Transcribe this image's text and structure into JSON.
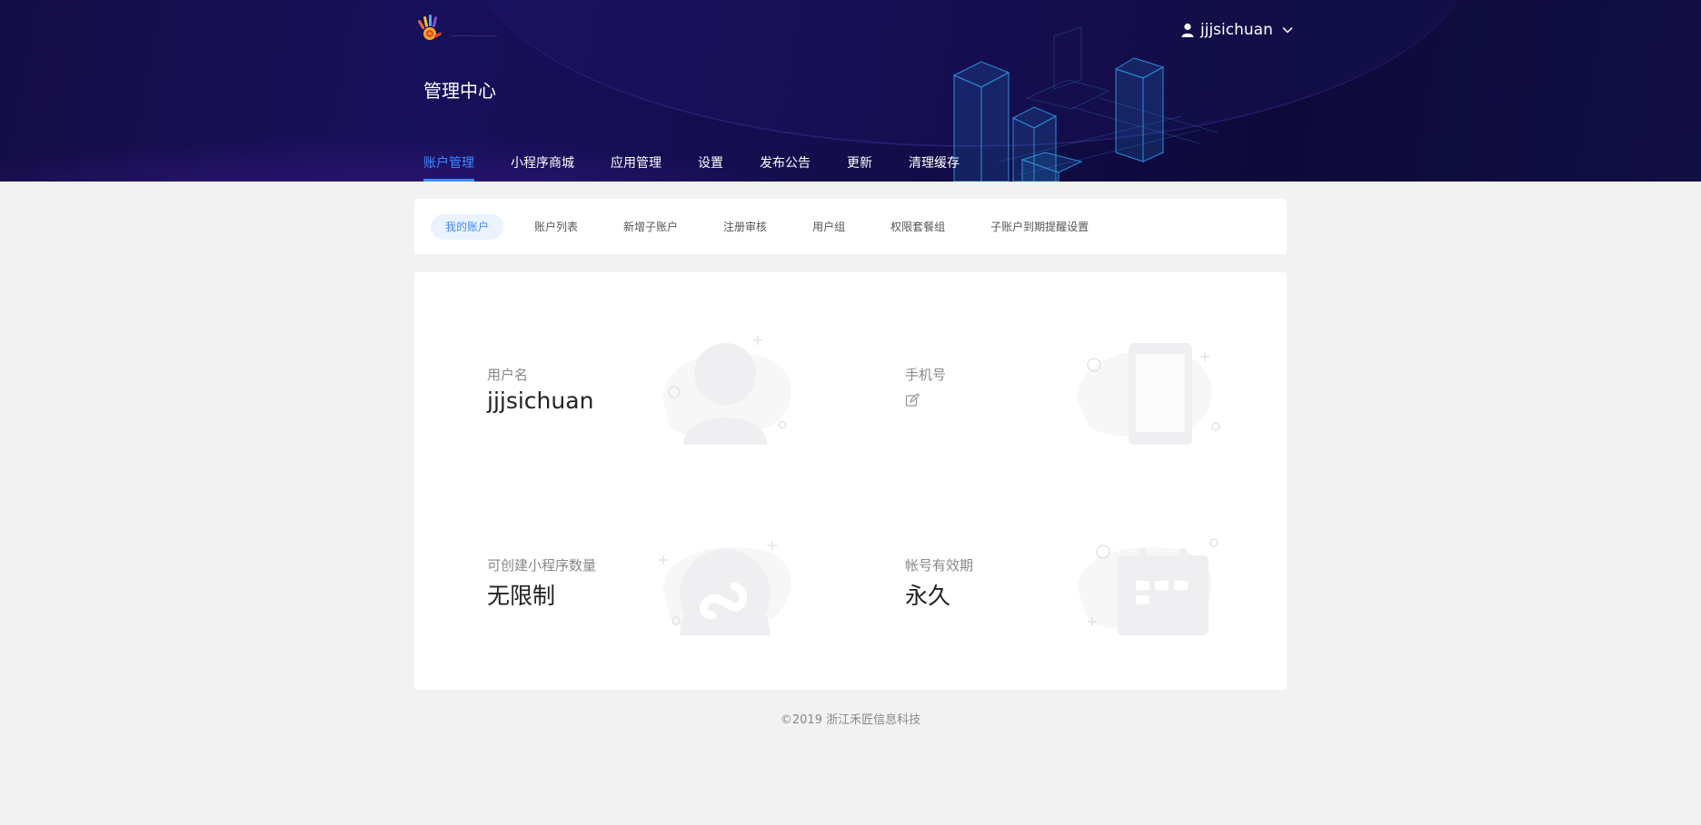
{
  "header": {
    "title": "管理中心",
    "username": "jjjsichuan",
    "nav": [
      {
        "label": "账户管理",
        "active": true
      },
      {
        "label": "小程序商城",
        "active": false
      },
      {
        "label": "应用管理",
        "active": false
      },
      {
        "label": "设置",
        "active": false
      },
      {
        "label": "发布公告",
        "active": false
      },
      {
        "label": "更新",
        "active": false
      },
      {
        "label": "清理缓存",
        "active": false
      }
    ]
  },
  "subnav": [
    {
      "label": "我的账户",
      "active": true
    },
    {
      "label": "账户列表",
      "active": false
    },
    {
      "label": "新增子账户",
      "active": false
    },
    {
      "label": "注册审核",
      "active": false
    },
    {
      "label": "用户组",
      "active": false
    },
    {
      "label": "权限套餐组",
      "active": false
    },
    {
      "label": "子账户到期提醒设置",
      "active": false
    }
  ],
  "account": {
    "username_label": "用户名",
    "username_value": "jjjsichuan",
    "phone_label": "手机号",
    "miniapp_label": "可创建小程序数量",
    "miniapp_value": "无限制",
    "expire_label": "帐号有效期",
    "expire_value": "永久"
  },
  "footer": "©2019 浙江禾匠信息科技",
  "colors": {
    "accent": "#3d8bff",
    "header_bg": "#130d4c",
    "page_bg": "#f2f2f2"
  },
  "icons": [
    "hand-logo-icon",
    "user-icon",
    "chevron-down-icon",
    "edit-icon",
    "user-illustration-icon",
    "phone-illustration-icon",
    "miniprogram-illustration-icon",
    "calendar-illustration-icon"
  ]
}
